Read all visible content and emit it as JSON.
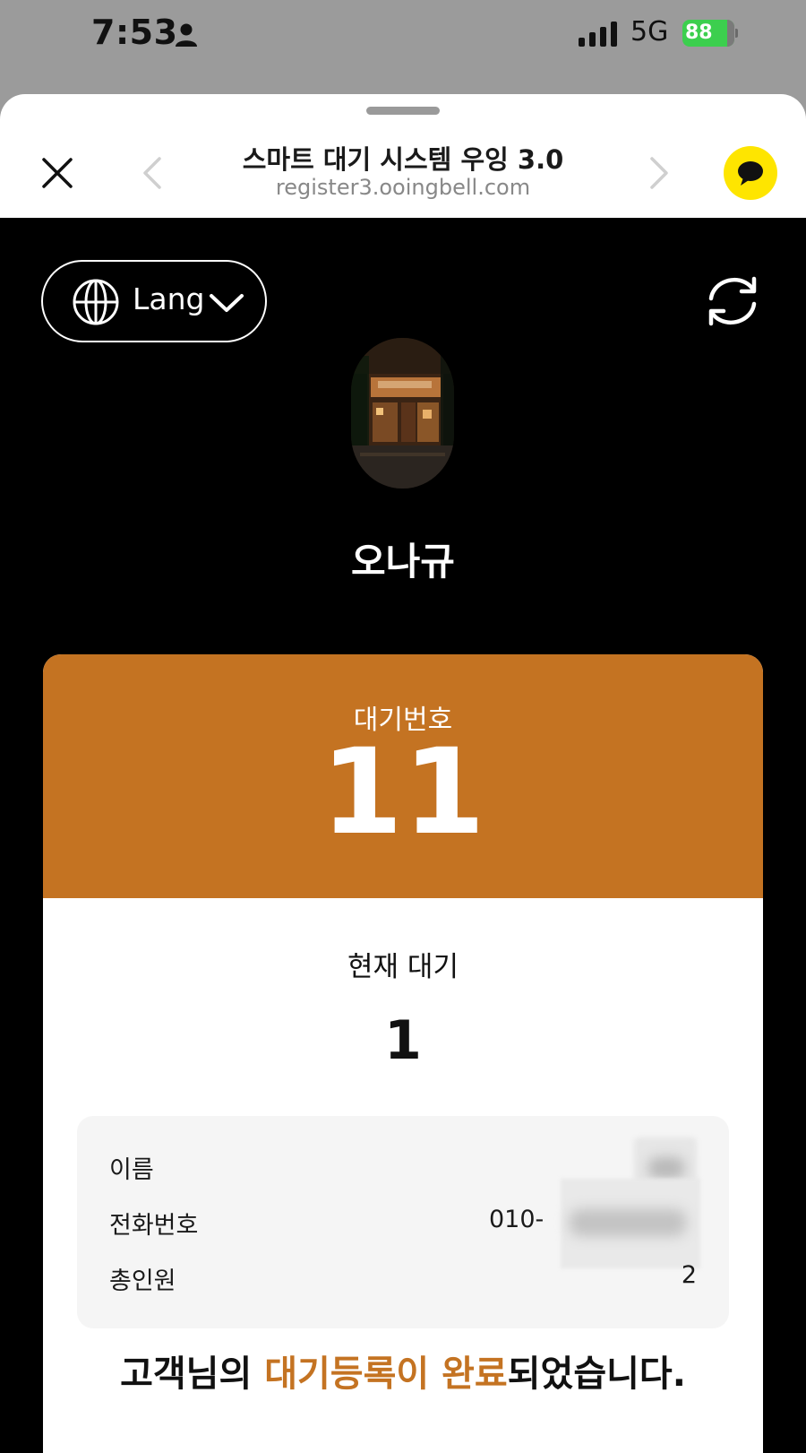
{
  "status_bar": {
    "time": "7:53",
    "network": "5G",
    "battery": "88"
  },
  "browser": {
    "title": "스마트 대기 시스템 우잉 3.0",
    "url": "register3.ooingbell.com"
  },
  "page": {
    "lang_label": "Lang",
    "store_name": "오나규",
    "wait_number_label": "대기번호",
    "wait_number": "11",
    "current_wait_label": "현재 대기",
    "current_wait": "1",
    "info": {
      "name_label": "이름",
      "phone_label": "전화번호",
      "phone_prefix": "010-",
      "party_label": "총인원",
      "party_size": "2"
    },
    "done_message": {
      "pre": "고객님의 ",
      "highlight": "대기등록이 완료",
      "post": "되었습니다."
    }
  },
  "colors": {
    "accent": "#c47322",
    "kakao_yellow": "#fee500",
    "battery_green": "#3ccf4e"
  },
  "icons": [
    "person-icon",
    "signal-icon",
    "battery-icon",
    "close-icon",
    "back-icon",
    "forward-icon",
    "kakao-chat-icon",
    "globe-icon",
    "chevron-down-icon",
    "refresh-icon"
  ]
}
